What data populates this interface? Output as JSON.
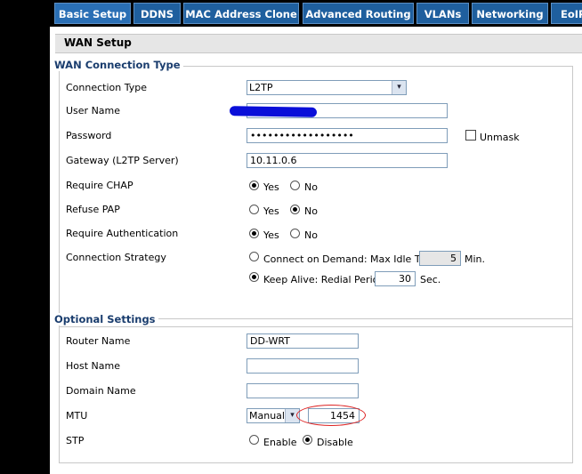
{
  "tabs": [
    {
      "label": "Basic Setup",
      "active": true
    },
    {
      "label": "DDNS"
    },
    {
      "label": "MAC Address Clone"
    },
    {
      "label": "Advanced Routing"
    },
    {
      "label": "VLANs"
    },
    {
      "label": "Networking"
    },
    {
      "label": "EoIP"
    }
  ],
  "wan": {
    "section_title": "WAN Setup",
    "legend": "WAN Connection Type",
    "connection_type": {
      "label": "Connection Type",
      "value": "L2TP"
    },
    "user_name": {
      "label": "User Name",
      "value": ""
    },
    "password": {
      "label": "Password",
      "value": "••••••••••••••••••",
      "unmask_label": "Unmask"
    },
    "gateway": {
      "label": "Gateway (L2TP Server)",
      "value": "10.11.0.6"
    },
    "require_chap": {
      "label": "Require CHAP",
      "yes": "Yes",
      "no": "No",
      "selected": "yes"
    },
    "refuse_pap": {
      "label": "Refuse PAP",
      "yes": "Yes",
      "no": "No",
      "selected": "no"
    },
    "require_auth": {
      "label": "Require Authentication",
      "yes": "Yes",
      "no": "No",
      "selected": "yes"
    },
    "strategy": {
      "label": "Connection Strategy",
      "demand_label": "Connect on Demand: Max Idle Time",
      "idle_value": "5",
      "idle_unit": "Min.",
      "keepalive_label": "Keep Alive: Redial Period",
      "redial_value": "30",
      "redial_unit": "Sec.",
      "selected": "keepalive"
    }
  },
  "optional": {
    "legend": "Optional Settings",
    "router_name": {
      "label": "Router Name",
      "value": "DD-WRT"
    },
    "host_name": {
      "label": "Host Name",
      "value": ""
    },
    "domain_name": {
      "label": "Domain Name",
      "value": ""
    },
    "mtu": {
      "label": "MTU",
      "mode": "Manual",
      "value": "1454"
    },
    "stp": {
      "label": "STP",
      "enable": "Enable",
      "disable": "Disable",
      "selected": "disable"
    }
  },
  "annotation_color": "#d22222",
  "redaction_color": "#0a0fd9"
}
